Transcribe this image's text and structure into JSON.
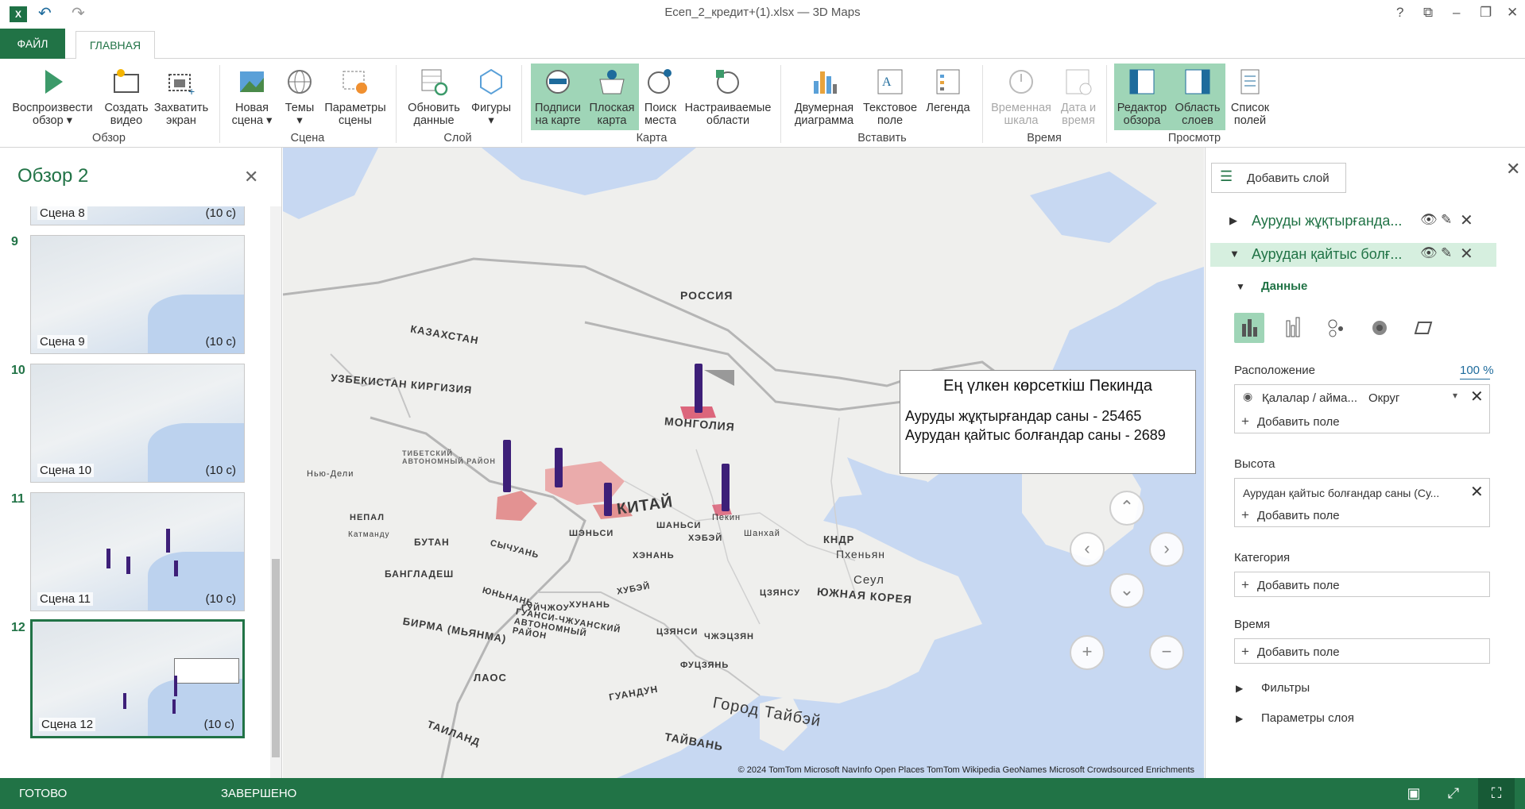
{
  "window": {
    "title": "Есеп_2_кредит+(1).xlsx — 3D Maps",
    "app_icon": "X",
    "help_label": "?"
  },
  "tabs": {
    "file": "ФАЙЛ",
    "home": "ГЛАВНАЯ"
  },
  "ribbon": {
    "groups": {
      "tour": "Обзор",
      "scene": "Сцена",
      "layer": "Слой",
      "map": "Карта",
      "insert": "Вставить",
      "time": "Время",
      "view": "Просмотр"
    },
    "buttons": {
      "play_tour": "Воспроизвести\nобзор ▾",
      "create_video": "Создать\nвидео",
      "capture_screen": "Захватить\nэкран",
      "new_scene": "Новая\nсцена ▾",
      "themes": "Темы\n▾",
      "scene_options": "Параметры\nсцены",
      "refresh_data": "Обновить\nданные",
      "shapes": "Фигуры\n▾",
      "map_labels": "Подписи\nна карте",
      "flat_map": "Плоская\nкарта",
      "find_location": "Поиск\nместа",
      "custom_regions": "Настраиваемые\nобласти",
      "2d_chart": "Двумерная\nдиаграмма",
      "text_box": "Текстовое\nполе",
      "legend": "Легенда",
      "timeline": "Временная\nшкала",
      "date_time": "Дата и\nвремя",
      "tour_editor": "Редактор\nобзора",
      "layer_pane": "Область\nслоев",
      "field_list": "Список\nполей"
    }
  },
  "tour": {
    "title": "Обзор 2",
    "scenes": [
      {
        "number": "",
        "caption": "Сцена 8",
        "duration": "(10 с)"
      },
      {
        "number": "9",
        "caption": "Сцена 9",
        "duration": "(10 с)"
      },
      {
        "number": "10",
        "caption": "Сцена 10",
        "duration": "(10 с)"
      },
      {
        "number": "11",
        "caption": "Сцена 11",
        "duration": "(10 с)"
      },
      {
        "number": "12",
        "caption": "Сцена 12",
        "duration": "(10 с)"
      }
    ]
  },
  "map": {
    "labels": {
      "russia": "РОССИЯ",
      "kazakhstan": "КАЗАХСТАН",
      "uzbekistan_kyrgyzstan": "УЗБЕКИСТАН КИРГИЗИЯ",
      "mongolia": "МОНГОЛИЯ",
      "china": "КИТАЙ",
      "tibet": "ТИБЕТСКИЙ\nАВТОНОМНЫЙ РАЙОН",
      "new_delhi": "Нью-Дели",
      "nepal": "НЕПАЛ",
      "bhutan": "БУТАН",
      "bangladesh": "БАНГЛАДЕШ",
      "kathmandu": "Катманду",
      "burma": "БИРМА (МЬЯНМА)",
      "laos": "ЛАОС",
      "thailand": "ТАИЛАНД",
      "guangxi": "ГУАНСИ-ЧЖУАНСКИЙ\nАВТОНОМНЫЙ\nРАЙОН",
      "yunnan": "ЮНЬНАНЬ",
      "guizhou": "ГУЙЧЖОУ",
      "sichuan": "СЫЧУАНЬ",
      "shaanxi": "ШЭНЬСИ",
      "shanxi": "ШАНЬСИ",
      "hebei": "ХЭБЭЙ",
      "beijing": "Пекин",
      "henan": "ХЭНАНЬ",
      "hubei": "ХУБЭЙ",
      "hunan": "ХУНАНЬ",
      "jiangxi": "ЦЗЯНСИ",
      "jiangsu": "ЦЗЯНСУ",
      "zhejiang": "ЧЖЭЦЗЯН",
      "guangdong": "ГУАНДУН",
      "fujian": "ФУЦЗЯНЬ",
      "taipei": "Город Тайбэй",
      "taiwan": "ТАЙВАНЬ",
      "dprk": "КНДР",
      "pyongyang": "Пхеньян",
      "seoul": "Сеул",
      "south_korea": "ЮЖНАЯ КОРЕЯ",
      "shanghai": "Шанхай"
    },
    "tooltip": {
      "title": "Ең үлкен көрсеткіш Пекинда",
      "line1": "Ауруды жұқтырғандар саны - 25465",
      "line2": "Аурудан қайтыс болғандар саны - 2689"
    },
    "attribution": "© 2024 TomTom   Microsoft   NavInfo   Open Places   TomTom   Wikipedia   GeoNames   Microsoft Crowdsourced Enrichments",
    "column_color": "#3d1f78",
    "region_color": "#e07a7a"
  },
  "layers_pane": {
    "add_layer": "Добавить слой",
    "layers": [
      {
        "name": "Ауруды жұқтырғанда...",
        "expanded": false
      },
      {
        "name": "Аурудан қайтыс болғ...",
        "expanded": true
      }
    ],
    "data_section": "Данные",
    "location": {
      "label": "Расположение",
      "percent": "100 %",
      "field": "Қалалар / айма...",
      "field_type": "Округ",
      "add": "Добавить поле"
    },
    "height": {
      "label": "Высота",
      "field": "Аурудан қайтыс болғандар саны (Су...",
      "add": "Добавить поле"
    },
    "category": {
      "label": "Категория",
      "add": "Добавить поле"
    },
    "time": {
      "label": "Время",
      "add": "Добавить поле"
    },
    "filters": "Фильтры",
    "layer_options": "Параметры слоя",
    "accent": "#217346"
  },
  "status": {
    "ready": "ГОТОВО",
    "done": "ЗАВЕРШЕНО"
  }
}
